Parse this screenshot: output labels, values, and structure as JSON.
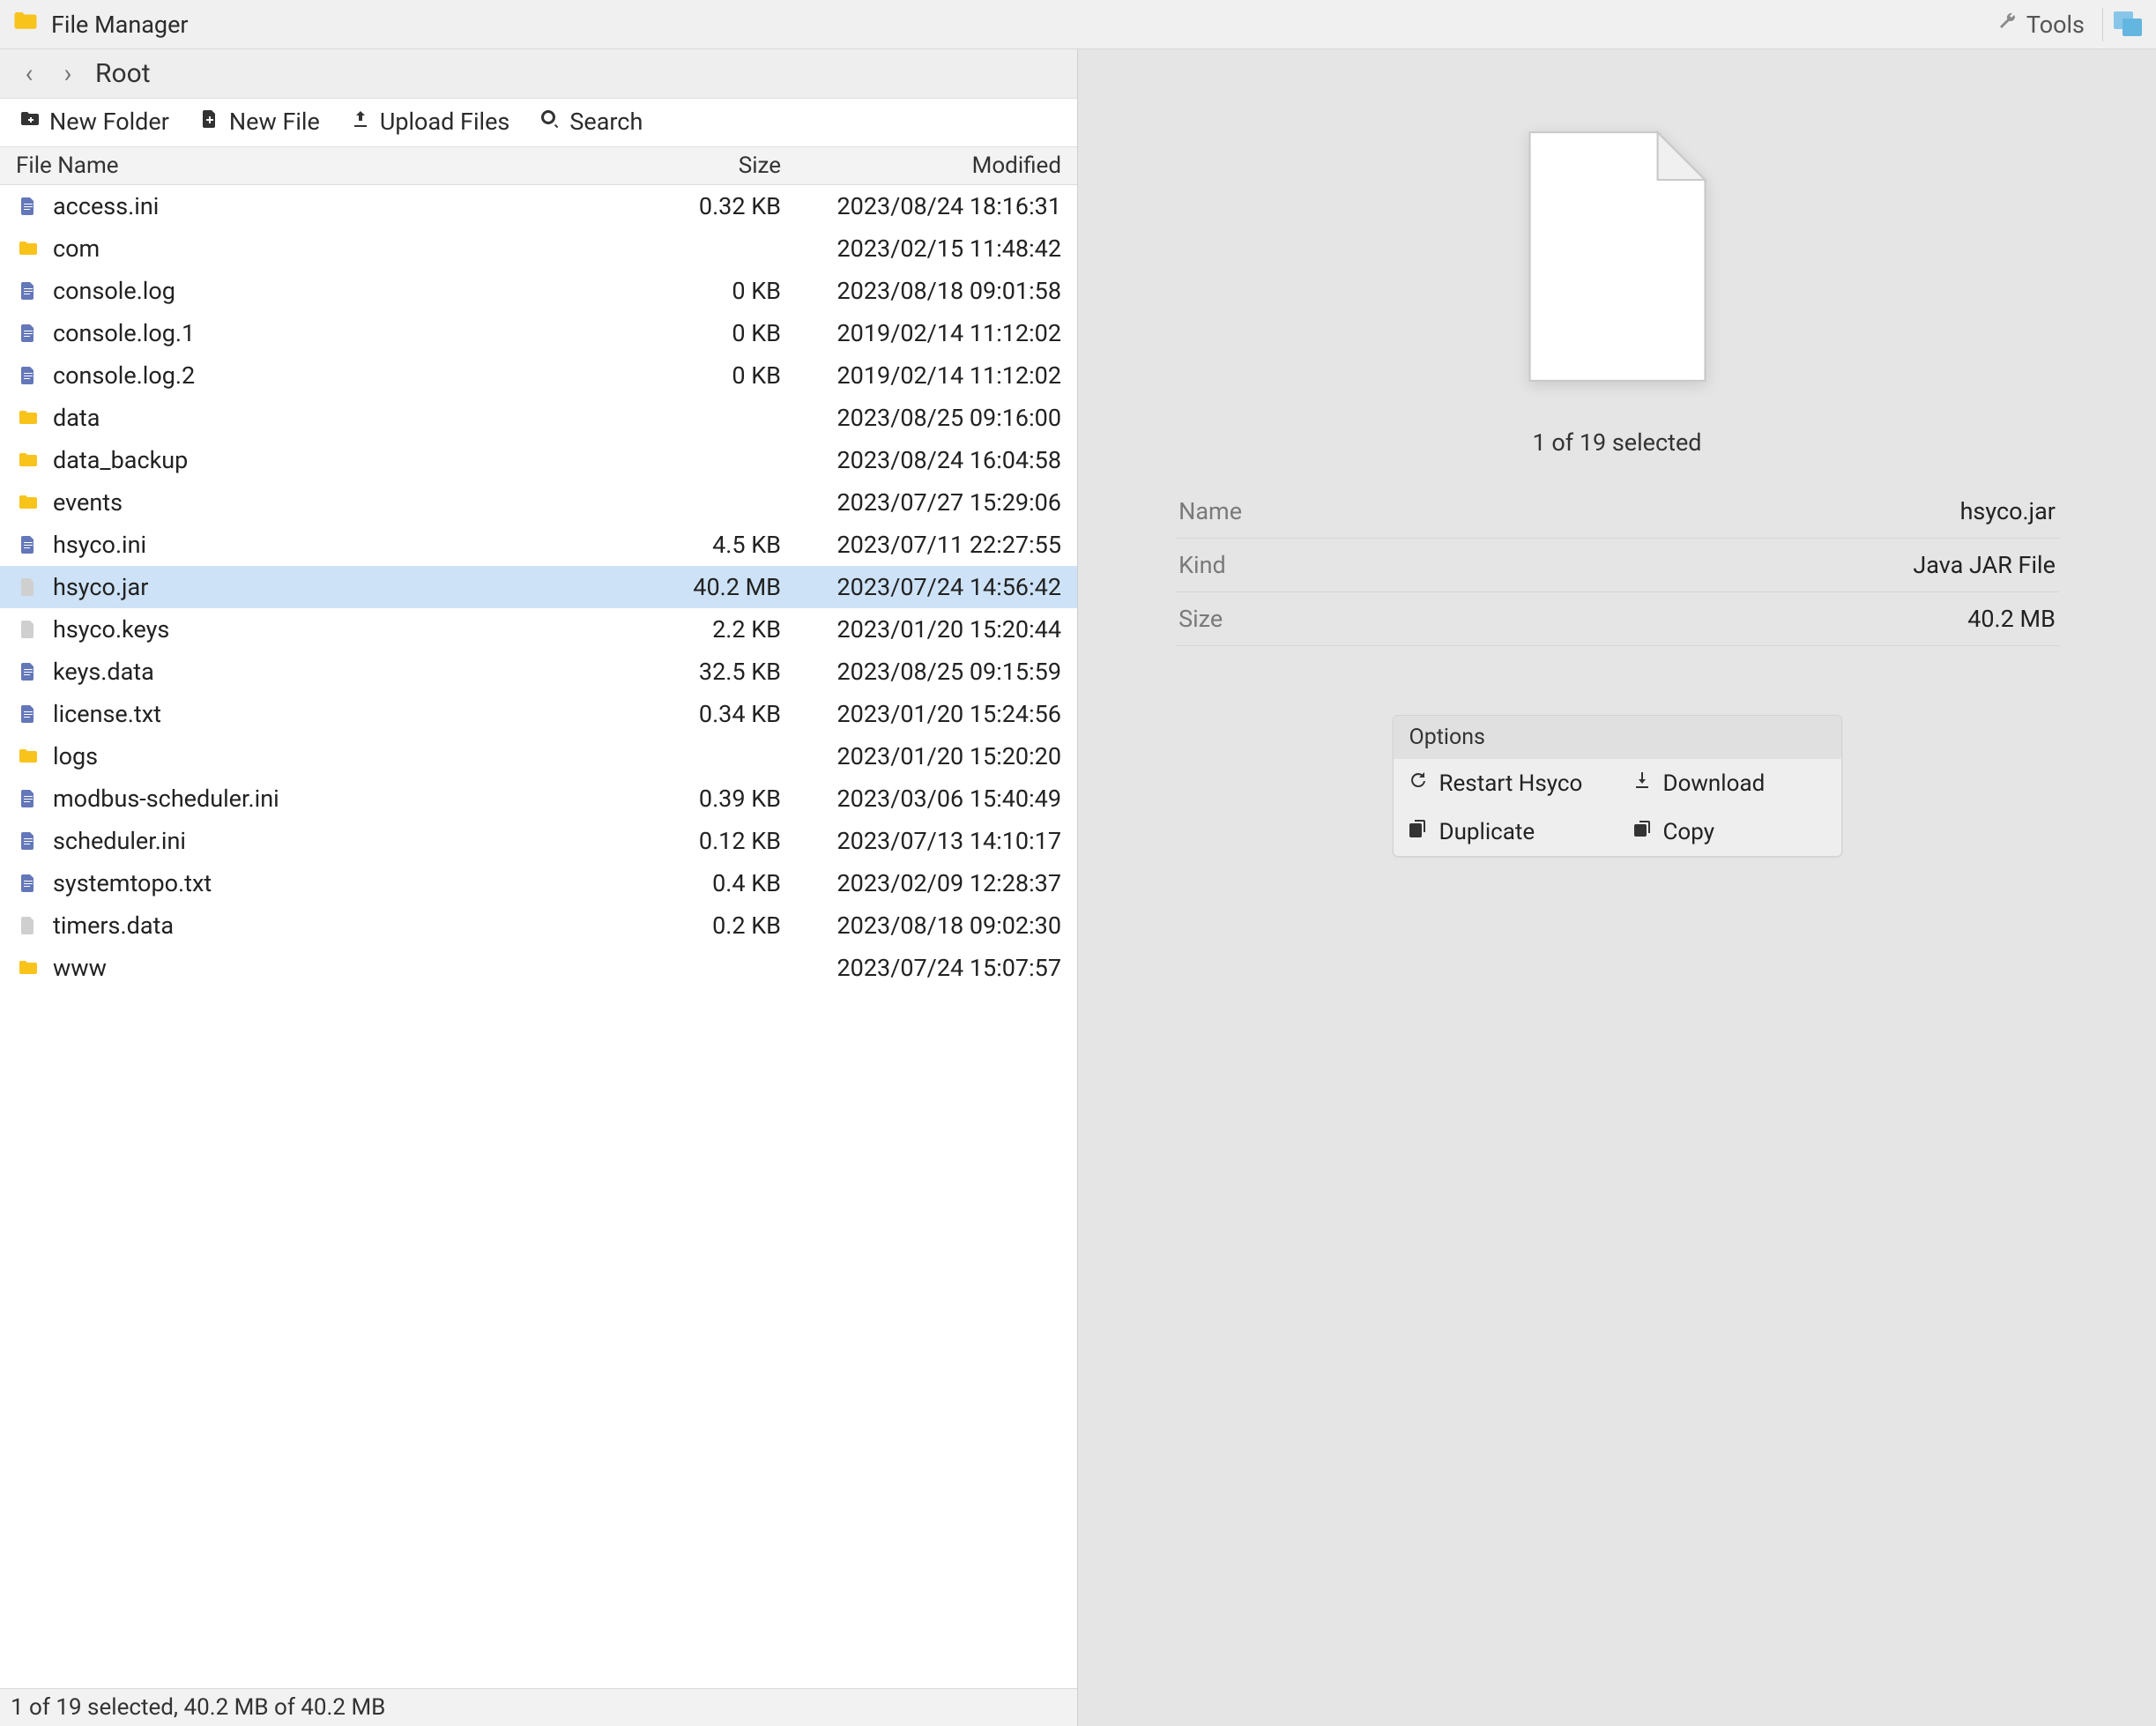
{
  "app": {
    "title": "File Manager",
    "tools_label": "Tools"
  },
  "nav": {
    "location": "Root"
  },
  "toolbar": {
    "new_folder": "New Folder",
    "new_file": "New File",
    "upload": "Upload Files",
    "search": "Search"
  },
  "columns": {
    "name": "File Name",
    "size": "Size",
    "modified": "Modified"
  },
  "files": [
    {
      "name": "access.ini",
      "size": "0.32 KB",
      "modified": "2023/08/24 18:16:31",
      "type": "doc",
      "selected": false
    },
    {
      "name": "com",
      "size": "",
      "modified": "2023/02/15 11:48:42",
      "type": "folder",
      "selected": false
    },
    {
      "name": "console.log",
      "size": "0 KB",
      "modified": "2023/08/18 09:01:58",
      "type": "doc",
      "selected": false
    },
    {
      "name": "console.log.1",
      "size": "0 KB",
      "modified": "2019/02/14 11:12:02",
      "type": "doc",
      "selected": false
    },
    {
      "name": "console.log.2",
      "size": "0 KB",
      "modified": "2019/02/14 11:12:02",
      "type": "doc",
      "selected": false
    },
    {
      "name": "data",
      "size": "",
      "modified": "2023/08/25 09:16:00",
      "type": "folder",
      "selected": false
    },
    {
      "name": "data_backup",
      "size": "",
      "modified": "2023/08/24 16:04:58",
      "type": "folder",
      "selected": false
    },
    {
      "name": "events",
      "size": "",
      "modified": "2023/07/27 15:29:06",
      "type": "folder",
      "selected": false
    },
    {
      "name": "hsyco.ini",
      "size": "4.5 KB",
      "modified": "2023/07/11 22:27:55",
      "type": "doc",
      "selected": false
    },
    {
      "name": "hsyco.jar",
      "size": "40.2 MB",
      "modified": "2023/07/24 14:56:42",
      "type": "faded",
      "selected": true
    },
    {
      "name": "hsyco.keys",
      "size": "2.2 KB",
      "modified": "2023/01/20 15:20:44",
      "type": "faded",
      "selected": false
    },
    {
      "name": "keys.data",
      "size": "32.5 KB",
      "modified": "2023/08/25 09:15:59",
      "type": "doc",
      "selected": false
    },
    {
      "name": "license.txt",
      "size": "0.34 KB",
      "modified": "2023/01/20 15:24:56",
      "type": "doc",
      "selected": false
    },
    {
      "name": "logs",
      "size": "",
      "modified": "2023/01/20 15:20:20",
      "type": "folder",
      "selected": false
    },
    {
      "name": "modbus-scheduler.ini",
      "size": "0.39 KB",
      "modified": "2023/03/06 15:40:49",
      "type": "doc",
      "selected": false
    },
    {
      "name": "scheduler.ini",
      "size": "0.12 KB",
      "modified": "2023/07/13 14:10:17",
      "type": "doc",
      "selected": false
    },
    {
      "name": "systemtopo.txt",
      "size": "0.4 KB",
      "modified": "2023/02/09 12:28:37",
      "type": "doc",
      "selected": false
    },
    {
      "name": "timers.data",
      "size": "0.2 KB",
      "modified": "2023/08/18 09:02:30",
      "type": "faded",
      "selected": false
    },
    {
      "name": "www",
      "size": "",
      "modified": "2023/07/24 15:07:57",
      "type": "folder",
      "selected": false
    }
  ],
  "status": "1 of 19 selected, 40.2 MB of 40.2 MB",
  "details": {
    "summary": "1 of 19 selected",
    "props": [
      {
        "k": "Name",
        "v": "hsyco.jar"
      },
      {
        "k": "Kind",
        "v": "Java JAR File"
      },
      {
        "k": "Size",
        "v": "40.2 MB"
      }
    ],
    "options_title": "Options",
    "options": {
      "restart": "Restart Hsyco",
      "download": "Download",
      "duplicate": "Duplicate",
      "copy": "Copy"
    }
  }
}
